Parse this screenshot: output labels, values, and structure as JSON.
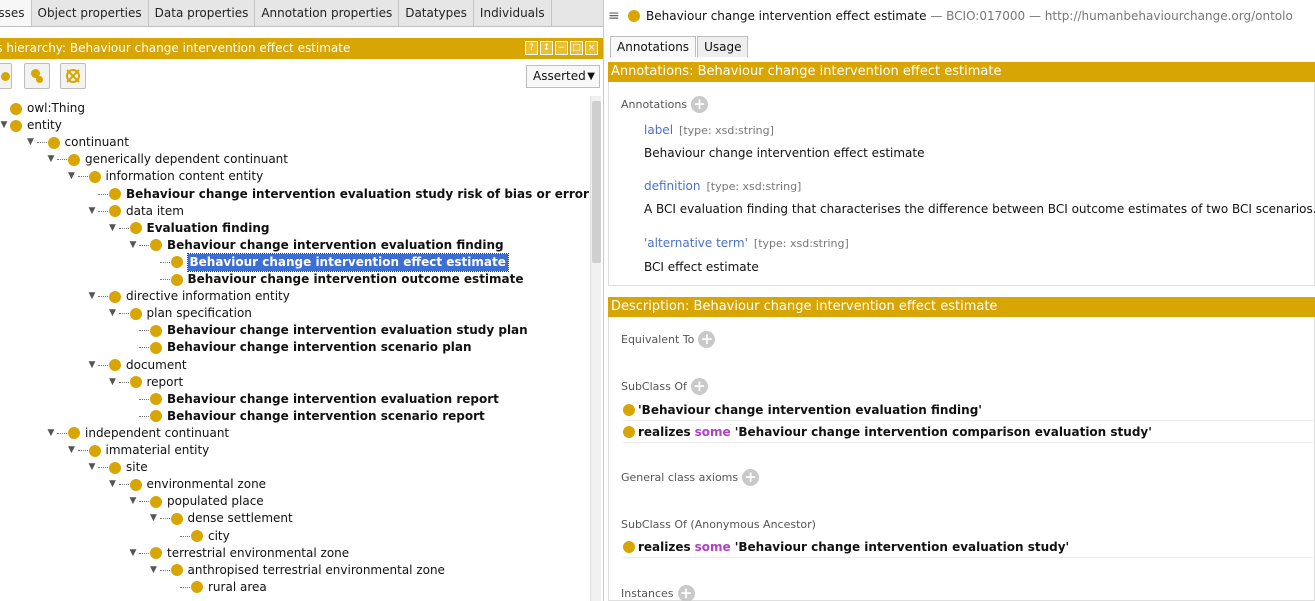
{
  "left": {
    "tabs": [
      "asses",
      "Object properties",
      "Data properties",
      "Annotation properties",
      "Datatypes",
      "Individuals"
    ],
    "title": "ss hierarchy: Behaviour change intervention effect estimate",
    "view_mode": "Asserted",
    "window_buttons": [
      "?",
      "↕",
      "−",
      "□",
      "×"
    ],
    "tree": [
      {
        "label": "owl:Thing",
        "depth": 0,
        "twisty": "",
        "bold": false,
        "selected": false
      },
      {
        "label": "entity",
        "depth": 0,
        "twisty": "▼",
        "bold": false,
        "selected": false
      },
      {
        "label": "continuant",
        "depth": 1,
        "twisty": "▼",
        "bold": false,
        "selected": false
      },
      {
        "label": "generically dependent continuant",
        "depth": 2,
        "twisty": "▼",
        "bold": false,
        "selected": false
      },
      {
        "label": "information content entity",
        "depth": 3,
        "twisty": "▼",
        "bold": false,
        "selected": false
      },
      {
        "label": "Behaviour change intervention evaluation study risk of bias or error",
        "depth": 4,
        "twisty": "",
        "bold": true,
        "selected": false
      },
      {
        "label": "data item",
        "depth": 4,
        "twisty": "▼",
        "bold": false,
        "selected": false
      },
      {
        "label": "Evaluation finding",
        "depth": 5,
        "twisty": "▼",
        "bold": true,
        "selected": false
      },
      {
        "label": "Behaviour change intervention evaluation finding",
        "depth": 6,
        "twisty": "▼",
        "bold": true,
        "selected": false
      },
      {
        "label": "Behaviour change intervention effect estimate",
        "depth": 7,
        "twisty": "",
        "bold": true,
        "selected": true
      },
      {
        "label": "Behaviour change intervention outcome estimate",
        "depth": 7,
        "twisty": "",
        "bold": true,
        "selected": false
      },
      {
        "label": "directive information entity",
        "depth": 4,
        "twisty": "▼",
        "bold": false,
        "selected": false
      },
      {
        "label": "plan specification",
        "depth": 5,
        "twisty": "▼",
        "bold": false,
        "selected": false
      },
      {
        "label": "Behaviour change intervention evaluation study plan",
        "depth": 6,
        "twisty": "",
        "bold": true,
        "selected": false
      },
      {
        "label": "Behaviour change intervention scenario plan",
        "depth": 6,
        "twisty": "",
        "bold": true,
        "selected": false
      },
      {
        "label": "document",
        "depth": 4,
        "twisty": "▼",
        "bold": false,
        "selected": false
      },
      {
        "label": "report",
        "depth": 5,
        "twisty": "▼",
        "bold": false,
        "selected": false
      },
      {
        "label": "Behaviour change intervention evaluation report",
        "depth": 6,
        "twisty": "",
        "bold": true,
        "selected": false
      },
      {
        "label": "Behaviour change intervention scenario report",
        "depth": 6,
        "twisty": "",
        "bold": true,
        "selected": false
      },
      {
        "label": "independent continuant",
        "depth": 2,
        "twisty": "▼",
        "bold": false,
        "selected": false
      },
      {
        "label": "immaterial entity",
        "depth": 3,
        "twisty": "▼",
        "bold": false,
        "selected": false
      },
      {
        "label": "site",
        "depth": 4,
        "twisty": "▼",
        "bold": false,
        "selected": false
      },
      {
        "label": "environmental zone",
        "depth": 5,
        "twisty": "▼",
        "bold": false,
        "selected": false
      },
      {
        "label": "populated place",
        "depth": 6,
        "twisty": "▼",
        "bold": false,
        "selected": false
      },
      {
        "label": "dense settlement",
        "depth": 7,
        "twisty": "▼",
        "bold": false,
        "selected": false
      },
      {
        "label": "city",
        "depth": 8,
        "twisty": "",
        "bold": false,
        "selected": false
      },
      {
        "label": "terrestrial environmental zone",
        "depth": 6,
        "twisty": "▼",
        "bold": false,
        "selected": false
      },
      {
        "label": "anthropised terrestrial environmental zone",
        "depth": 7,
        "twisty": "▼",
        "bold": false,
        "selected": false
      },
      {
        "label": "rural area",
        "depth": 8,
        "twisty": "",
        "bold": false,
        "selected": false
      }
    ]
  },
  "right": {
    "header": {
      "menu_icon": "≡",
      "name": "Behaviour change intervention effect estimate",
      "meta": " — BCIO:017000 — http://humanbehaviourchange.org/ontolo"
    },
    "tabs": [
      "Annotations",
      "Usage"
    ],
    "annotations_title": "Annotations: Behaviour change intervention effect estimate",
    "annotations_header": "Annotations",
    "annotations": [
      {
        "property": "label",
        "type": "[type: xsd:string]",
        "value": "Behaviour change intervention effect estimate"
      },
      {
        "property": "definition",
        "type": "[type: xsd:string]",
        "value": "A BCI evaluation finding that characterises the difference between BCI outcome estimates of two BCI scenarios."
      },
      {
        "property": "'alternative term'",
        "type": "[type: xsd:string]",
        "value": "BCI effect estimate"
      }
    ],
    "description_title": "Description: Behaviour change intervention effect estimate",
    "equivalent_to": "Equivalent To",
    "subclass_of": "SubClass Of",
    "subclass_items": [
      {
        "text": "'Behaviour change intervention evaluation finding'",
        "keyword": "",
        "rest": ""
      },
      {
        "text": "realizes",
        "keyword": "some",
        "rest": "'Behaviour change intervention comparison evaluation study'"
      }
    ],
    "general_axioms": "General class axioms",
    "subclass_anon": "SubClass Of (Anonymous Ancestor)",
    "anon_items": [
      {
        "text": "realizes",
        "keyword": "some",
        "rest": "'Behaviour change intervention evaluation study'"
      }
    ],
    "instances": "Instances",
    "plus_symbol": "+"
  },
  "colors": {
    "accent": "#d8a604",
    "selection": "#3d6fd2",
    "property": "#4a72c4",
    "keyword": "#b33ec9"
  }
}
